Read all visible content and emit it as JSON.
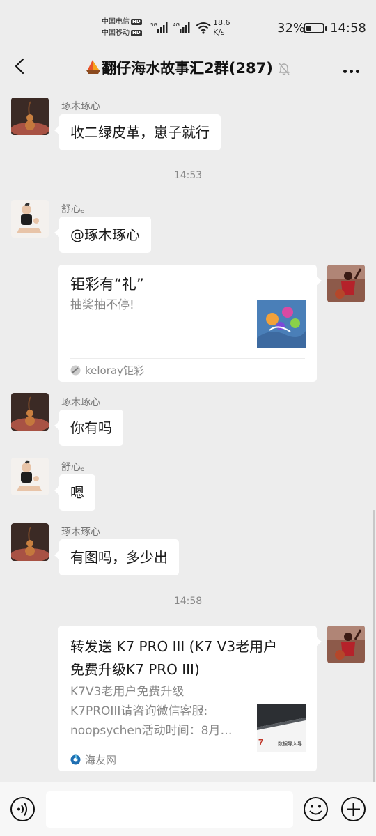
{
  "status_bar": {
    "carrier1": "中国电信",
    "carrier2": "中国移动",
    "hd_badge": "HD",
    "net_5g": "5G",
    "net_4g": "4G",
    "speed_value": "18.6",
    "speed_unit": "K/s",
    "battery_percent": "32%",
    "battery_level": 0.32,
    "time": "14:58"
  },
  "header": {
    "title_icon": "sailboat-emoji",
    "title": "翻仔海水故事汇2群(287)",
    "mute_icon": "bell-off-icon",
    "more_icon": "more-dots-icon",
    "back_icon": "chevron-left-icon"
  },
  "messages": {
    "m1": {
      "sender": "琢木琢心",
      "text": "收二绿皮革，崽子就行"
    },
    "t1": "14:53",
    "m2": {
      "sender": "舒心。",
      "text": "@琢木琢心"
    },
    "m3": {
      "title": "钜彩有“礼”",
      "desc": "抽奖抽不停!",
      "source": "keloray钜彩"
    },
    "m4": {
      "sender": "琢木琢心",
      "text": "你有吗"
    },
    "m5": {
      "sender": "舒心。",
      "text": "嗯"
    },
    "m6": {
      "sender": "琢木琢心",
      "text": "有图吗，多少出"
    },
    "t2": "14:58",
    "m7": {
      "title_line1": "转发送 K7 PRO III (K7 V3老用户",
      "title_line2": "免费升级K7 PRO III)",
      "desc_line1": "K7V3老用户免费升级",
      "desc_line2": "K7PROIII请咨询微信客服:",
      "desc_line3": "noopsychen活动时间：8月…",
      "thumb_text_big": "7",
      "thumb_text_small": "数据导入导",
      "source": "海友网"
    }
  },
  "input_bar": {
    "voice_icon": "voice-icon",
    "emoji_icon": "emoji-icon",
    "plus_icon": "plus-icon"
  }
}
